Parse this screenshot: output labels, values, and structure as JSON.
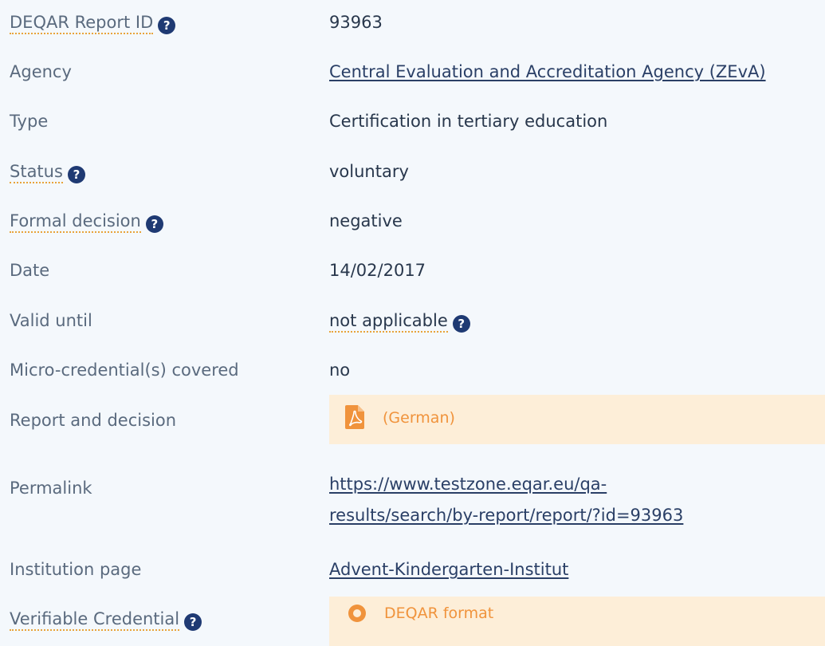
{
  "rows": [
    {
      "label": "DEQAR Report ID",
      "value": "93963"
    },
    {
      "label": "Agency",
      "value": "Central Evaluation and Accreditation Agency (ZEvA)"
    },
    {
      "label": "Type",
      "value": "Certification in tertiary education"
    },
    {
      "label": "Status",
      "value": "voluntary"
    },
    {
      "label": "Formal decision",
      "value": "negative"
    },
    {
      "label": "Date",
      "value": "14/02/2017"
    },
    {
      "label": "Valid until",
      "value": "not applicable"
    },
    {
      "label": "Micro-credential(s) covered",
      "value": "no"
    },
    {
      "label": "Report and decision",
      "value": "(German)"
    },
    {
      "label": "Permalink",
      "value_line1": "https://www.testzone.eqar.eu/qa-",
      "value_line2": "results/search/by-report/report/?id=93963"
    },
    {
      "label": "Institution page",
      "value": "Advent-Kindergarten-Institut"
    },
    {
      "label": "Verifiable Credential",
      "value": "DEQAR format"
    }
  ],
  "help_glyph": "?",
  "colors": {
    "background": "#f4f8fc",
    "label": "#5a6a7e",
    "value": "#28374c",
    "help_icon": "#1f3a73",
    "accent_orange": "#f0933c",
    "doc_box": "#fdeed8",
    "dotted_underline": "#e8a33a"
  },
  "icons": {
    "help": "question-circle-icon",
    "report": "pdf-file-icon",
    "credential": "certificate-icon"
  }
}
